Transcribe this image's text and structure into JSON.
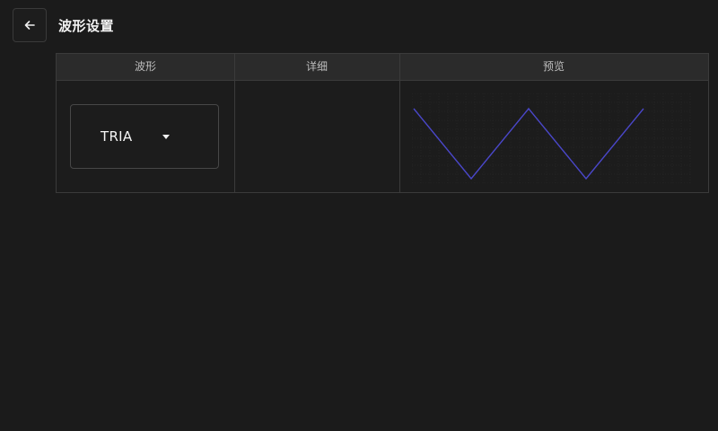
{
  "header": {
    "title": "波形设置",
    "back_icon": "arrow-left-icon"
  },
  "table": {
    "columns": [
      "波形",
      "详细",
      "预览"
    ]
  },
  "waveform": {
    "selected": "TRIA",
    "dropdown_icon": "caret-down-icon"
  },
  "preview": {
    "line_color": "#4a47c9",
    "grid_color": "#2a2a2a",
    "shape": "triangle"
  },
  "chart_data": {
    "type": "line",
    "x": [
      0,
      1,
      2,
      3,
      4
    ],
    "series": [
      {
        "values": [
          1,
          -1,
          1,
          -1,
          1
        ]
      }
    ],
    "ylim": [
      -1,
      1
    ],
    "grid": true
  }
}
